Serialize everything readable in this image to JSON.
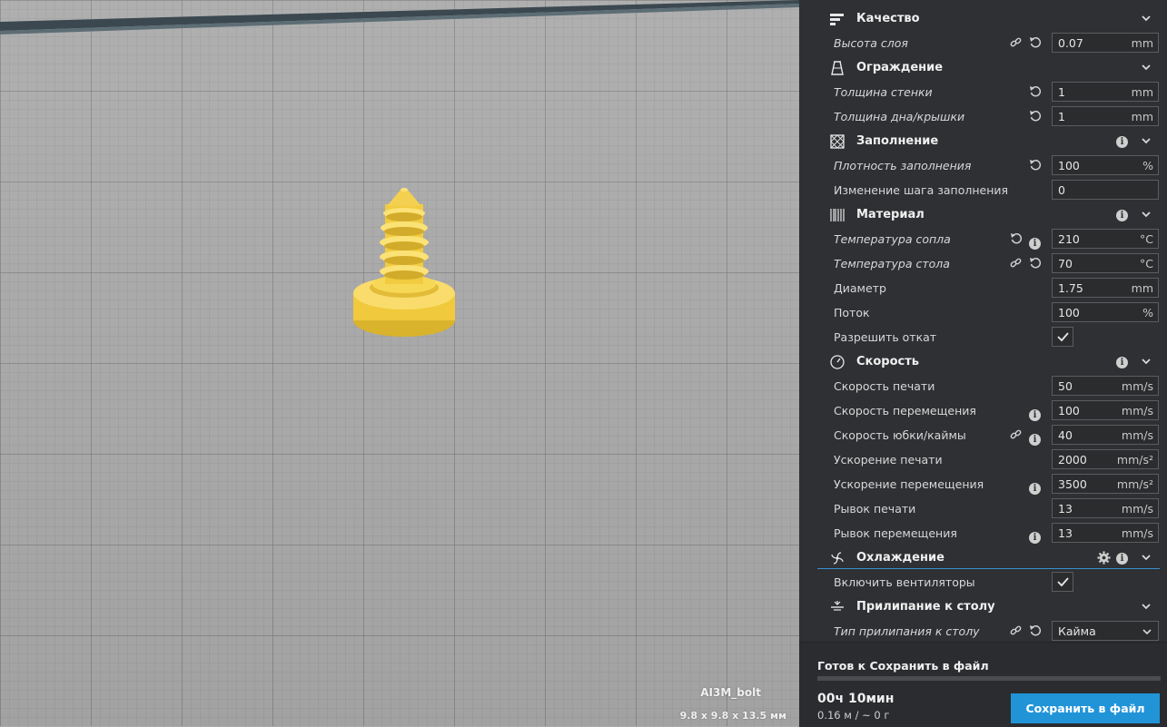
{
  "model": {
    "name": "AI3M_bolt",
    "dimensions": "9.8 x 9.8 x 13.5 мм",
    "color": "#f5d44a"
  },
  "sidebar": {
    "categories": {
      "quality": {
        "label": "Качество",
        "icon": "quality-icon"
      },
      "shell": {
        "label": "Ограждение",
        "icon": "shell-icon"
      },
      "infill": {
        "label": "Заполнение",
        "icon": "infill-icon"
      },
      "material": {
        "label": "Материал",
        "icon": "material-icon"
      },
      "speed": {
        "label": "Скорость",
        "icon": "speed-icon"
      },
      "cooling": {
        "label": "Охлаждение",
        "icon": "fan-icon"
      },
      "adhesion": {
        "label": "Прилипание к столу",
        "icon": "adhesion-icon"
      }
    },
    "settings": {
      "layer_height": {
        "label": "Высота слоя",
        "value": "0.07",
        "unit": "mm"
      },
      "wall_thickness": {
        "label": "Толщина стенки",
        "value": "1",
        "unit": "mm"
      },
      "top_bottom_thickness": {
        "label": "Толщина дна/крышки",
        "value": "1",
        "unit": "mm"
      },
      "infill_density": {
        "label": "Плотность заполнения",
        "value": "100",
        "unit": "%"
      },
      "gradual_infill": {
        "label": "Изменение шага заполнения",
        "value": "0",
        "unit": ""
      },
      "nozzle_temp": {
        "label": "Температура сопла",
        "value": "210",
        "unit": "°C"
      },
      "bed_temp": {
        "label": "Температура стола",
        "value": "70",
        "unit": "°C"
      },
      "diameter": {
        "label": "Диаметр",
        "value": "1.75",
        "unit": "mm"
      },
      "flow": {
        "label": "Поток",
        "value": "100",
        "unit": "%"
      },
      "retraction": {
        "label": "Разрешить откат",
        "checked": true
      },
      "print_speed": {
        "label": "Скорость печати",
        "value": "50",
        "unit": "mm/s"
      },
      "travel_speed": {
        "label": "Скорость перемещения",
        "value": "100",
        "unit": "mm/s"
      },
      "skirt_speed": {
        "label": "Скорость юбки/каймы",
        "value": "40",
        "unit": "mm/s"
      },
      "print_accel": {
        "label": "Ускорение печати",
        "value": "2000",
        "unit": "mm/s²"
      },
      "travel_accel": {
        "label": "Ускорение перемещения",
        "value": "3500",
        "unit": "mm/s²"
      },
      "print_jerk": {
        "label": "Рывок печати",
        "value": "13",
        "unit": "mm/s"
      },
      "travel_jerk": {
        "label": "Рывок перемещения",
        "value": "13",
        "unit": "mm/s"
      },
      "fans": {
        "label": "Включить вентиляторы",
        "checked": true
      },
      "adhesion_type": {
        "label": "Тип прилипания к столу",
        "value": "Кайма"
      }
    }
  },
  "output": {
    "status": "Готов к Сохранить в файл",
    "progress": 0,
    "time": "00ч 10мин",
    "material": "0.16 м / ~ 0 г",
    "save_label": "Сохранить в файл"
  },
  "colors": {
    "accent": "#2194d8",
    "panel": "#2e3033",
    "viewport": "#ababab"
  }
}
